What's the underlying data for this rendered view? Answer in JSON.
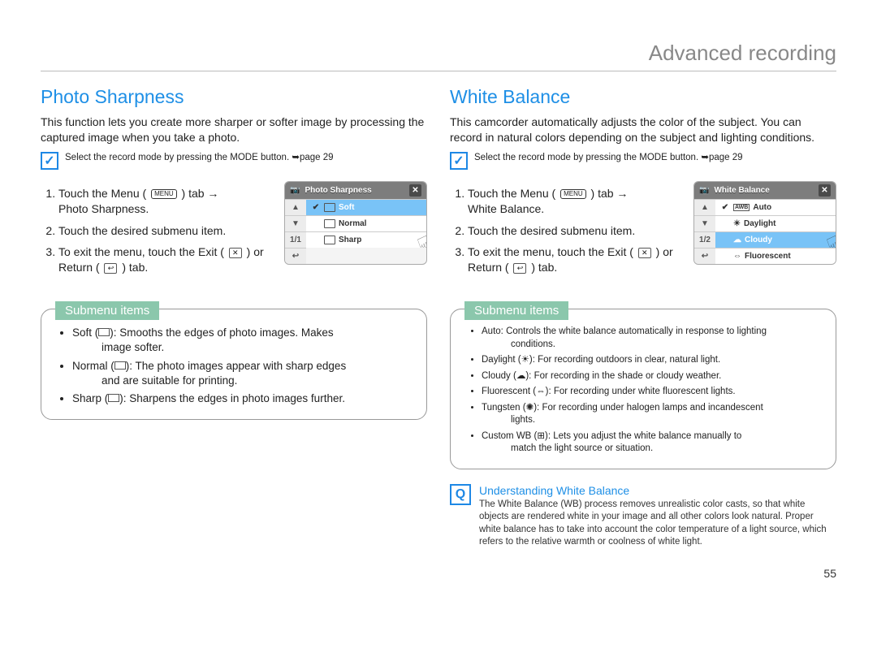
{
  "page": {
    "title": "Advanced recording",
    "number": "55"
  },
  "tip_text": "Select the record mode by pressing the MODE button. ➥page 29",
  "menu_label": "MENU",
  "icons": {
    "exit": "✕",
    "return": "↩"
  },
  "left": {
    "heading": "Photo Sharpness",
    "intro": "This function lets you create more sharper or softer image by processing the captured image when you take a photo.",
    "steps": {
      "s1a": "Touch the Menu (",
      "s1b": ") tab →",
      "s1c": "Photo Sharpness.",
      "s2": "Touch the desired submenu item.",
      "s3a": "To exit the menu, touch the Exit (",
      "s3b": ") or Return (",
      "s3c": ") tab."
    },
    "lcd": {
      "title": "Photo Sharpness",
      "nav": [
        "▲",
        "▼",
        "1/1",
        "↩"
      ],
      "items": [
        {
          "label": "Soft",
          "checked": true,
          "selected": true
        },
        {
          "label": "Normal",
          "checked": false,
          "selected": false
        },
        {
          "label": "Sharp",
          "checked": false,
          "selected": false
        }
      ]
    },
    "sub_label": "Submenu items",
    "sub": {
      "i0": {
        "name": "Soft",
        "desc": "Smooths the edges of photo images. Makes",
        "cont": "image softer."
      },
      "i1": {
        "name": "Normal",
        "desc": "The photo images appear with sharp edges",
        "cont": "and are suitable for printing."
      },
      "i2": {
        "name": "Sharp",
        "desc": "Sharpens the edges in photo images further."
      }
    }
  },
  "right": {
    "heading": "White Balance",
    "intro": "This camcorder automatically adjusts the color of the subject. You can record in natural colors depending on the subject and lighting conditions.",
    "steps": {
      "s1a": "Touch the Menu (",
      "s1b": ") tab →",
      "s1c": "White Balance.",
      "s2": "Touch the desired submenu item.",
      "s3a": "To exit the menu, touch the Exit (",
      "s3b": ") or Return (",
      "s3c": ") tab."
    },
    "lcd": {
      "title": "White Balance",
      "nav": [
        "▲",
        "▼",
        "1/2",
        "↩"
      ],
      "items": [
        {
          "label": "Auto",
          "checked": true,
          "selected": false
        },
        {
          "label": "Daylight",
          "checked": false,
          "selected": false
        },
        {
          "label": "Cloudy",
          "checked": false,
          "selected": true
        },
        {
          "label": "Fluorescent",
          "checked": false,
          "selected": false
        }
      ]
    },
    "sub_label": "Submenu items",
    "sub": {
      "i0": {
        "name": "Auto",
        "desc": "Controls the white balance automatically in response to lighting",
        "cont": "conditions."
      },
      "i1": {
        "name": "Daylight",
        "desc": "For recording outdoors in clear, natural light."
      },
      "i2": {
        "name": "Cloudy",
        "desc": "For recording in the shade or cloudy weather."
      },
      "i3": {
        "name": "Fluorescent",
        "desc": "For recording under white fluorescent lights."
      },
      "i4": {
        "name": "Tungsten",
        "desc": "For recording under halogen lamps and incandescent",
        "cont": "lights."
      },
      "i5": {
        "name": "Custom WB",
        "desc": "Lets you adjust the white balance manually to",
        "cont": "match the light source or situation."
      }
    },
    "note": {
      "title": "Understanding White Balance",
      "body": "The White Balance (WB) process removes unrealistic color casts, so that white objects are rendered white in your image and all other colors look natural. Proper white balance has to take into account the  color temperature  of a light source, which refers to the relative warmth or coolness of white light."
    }
  }
}
